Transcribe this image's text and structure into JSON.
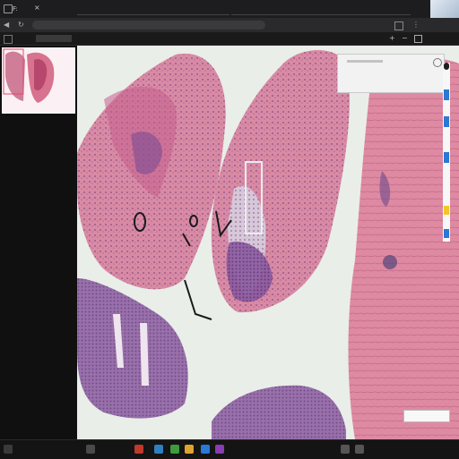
{
  "browser": {
    "tabs": [
      {
        "label": "F:"
      },
      {
        "label": ""
      },
      {
        "label": ""
      }
    ],
    "address_text": "",
    "viewer_title": ""
  },
  "viewer": {
    "scale_label": ""
  },
  "taskbar": {
    "clock": ""
  },
  "colors": {
    "accent": "#2a79d4",
    "tissue_pink": "#d57c9c",
    "tissue_purple": "#6e4c8e",
    "background": "#e9eee8"
  }
}
